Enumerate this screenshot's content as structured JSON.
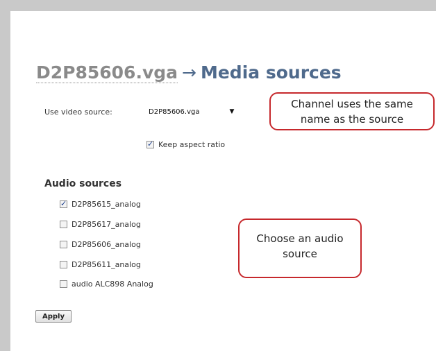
{
  "page": {
    "title_source": "D2P85606.vga",
    "title_arrow": "→",
    "title_section": "Media sources"
  },
  "video": {
    "label": "Use video source:",
    "selected": "D2P85606.vga",
    "keep_aspect_label": "Keep aspect ratio",
    "keep_aspect_checked": true
  },
  "audio": {
    "heading": "Audio sources",
    "items": [
      {
        "label": "D2P85615_analog",
        "checked": true
      },
      {
        "label": "D2P85617_analog",
        "checked": false
      },
      {
        "label": "D2P85606_analog",
        "checked": false
      },
      {
        "label": "D2P85611_analog",
        "checked": false
      },
      {
        "label": "audio ALC898 Analog",
        "checked": false
      }
    ]
  },
  "apply_label": "Apply",
  "callouts": {
    "channel_line1": "Channel uses the same",
    "channel_line2": "name as the source",
    "audio_line1": "Choose an audio",
    "audio_line2": "source"
  },
  "colors": {
    "title": "#4f6a8c",
    "callout_border": "#c6282c"
  }
}
